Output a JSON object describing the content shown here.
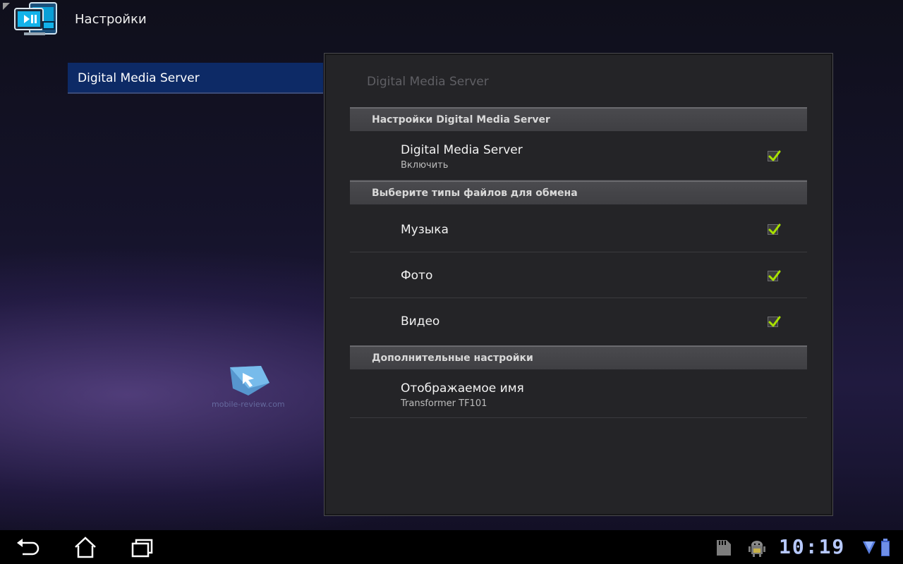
{
  "actionbar": {
    "title": "Настройки",
    "app_icon": "dms-app-icon"
  },
  "left_list": {
    "items": [
      {
        "label": "Digital Media Server",
        "selected": true
      }
    ]
  },
  "panel": {
    "title": "Digital Media Server",
    "sections": [
      {
        "label": "Настройки Digital Media Server"
      },
      {
        "label": "Выберите типы файлов для обмена"
      },
      {
        "label": "Дополнительные настройки"
      }
    ],
    "rows": {
      "dms": {
        "title": "Digital Media Server",
        "subtitle": "Включить",
        "checked": true
      },
      "music": {
        "title": "Музыка",
        "checked": true
      },
      "photo": {
        "title": "Фото",
        "checked": true
      },
      "video": {
        "title": "Видео",
        "checked": true
      },
      "display_name": {
        "title": "Отображаемое имя",
        "subtitle": "Transformer TF101"
      }
    }
  },
  "watermark": {
    "text": "mobile-review.com"
  },
  "navbar": {
    "buttons": [
      "back-icon",
      "home-icon",
      "recent-apps-icon"
    ],
    "status_icons": [
      "sd-card-icon",
      "android-debug-icon",
      "wifi-icon",
      "battery-icon"
    ],
    "clock": "10:19"
  },
  "colors": {
    "check_green": "#a8e000",
    "selected_item": "#0d2a66",
    "clock": "#b7c9ff"
  }
}
